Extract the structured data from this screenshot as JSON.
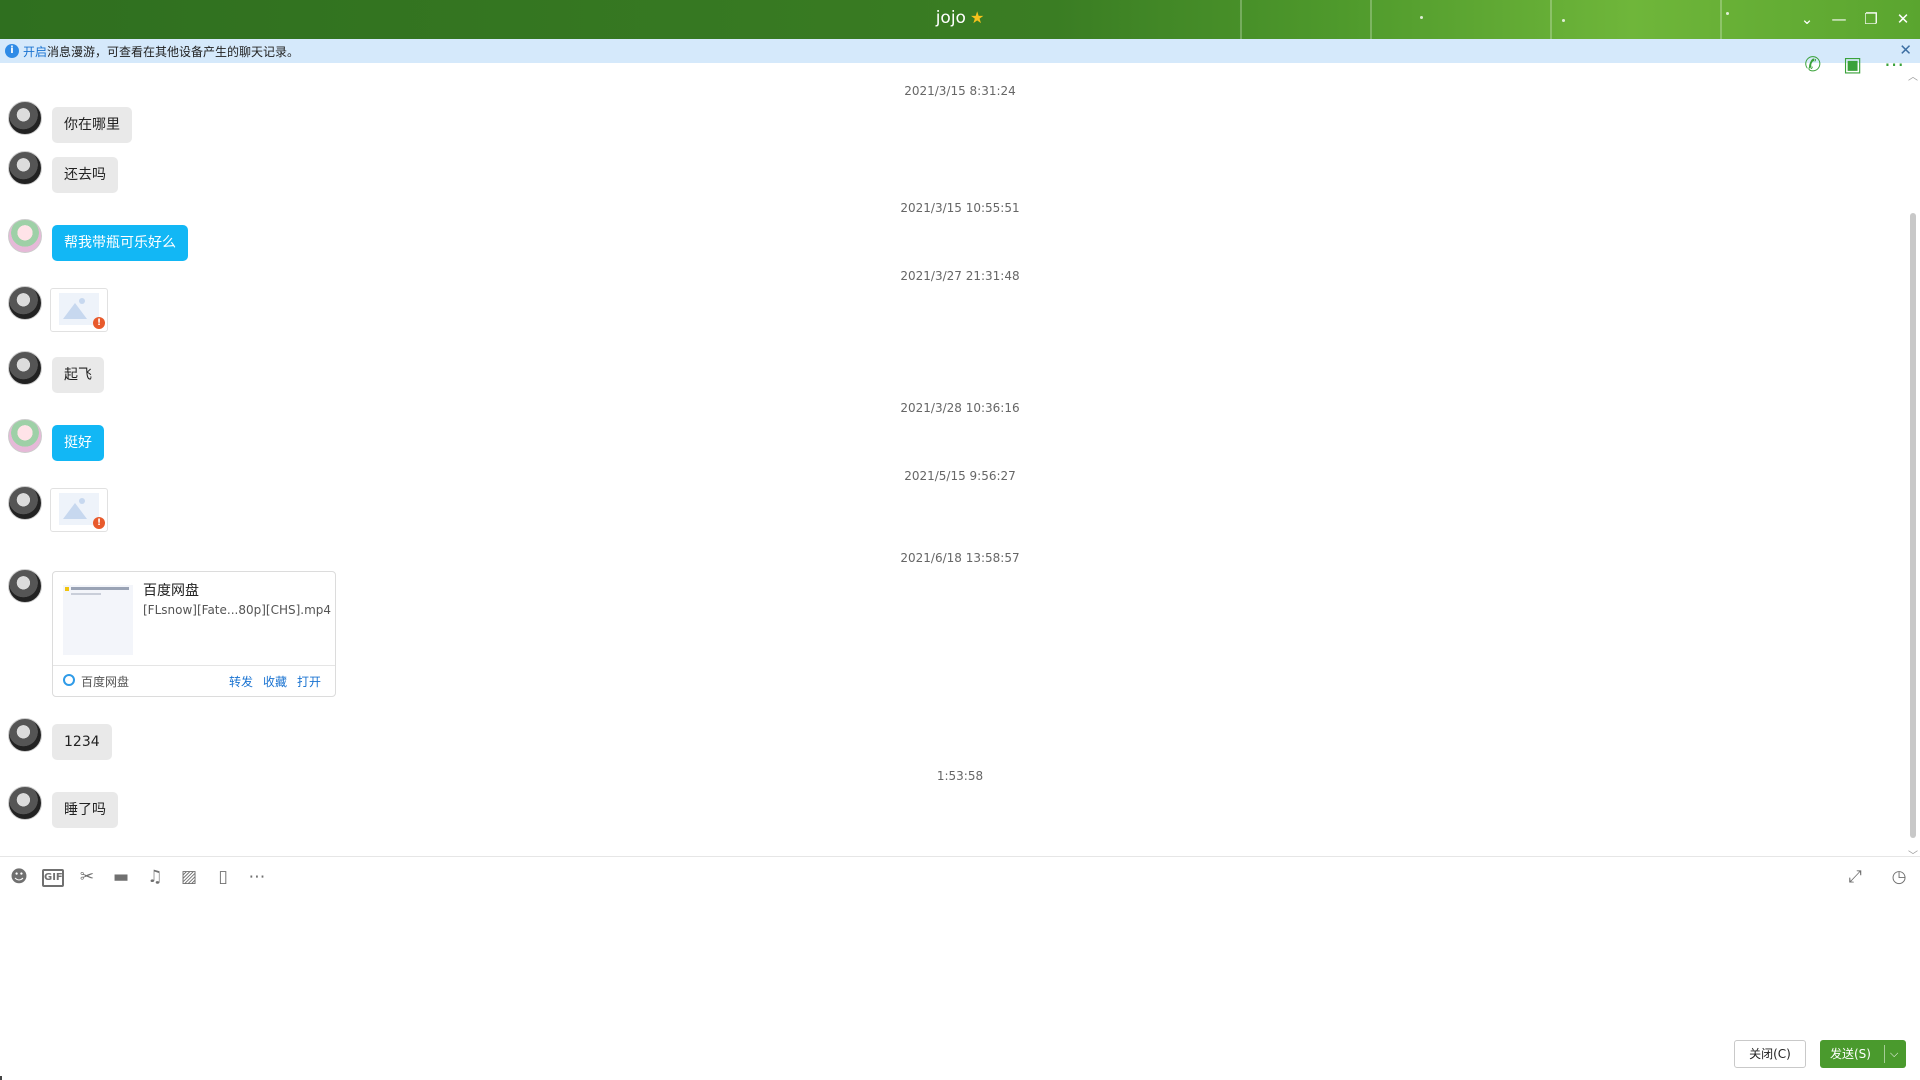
{
  "window": {
    "title": "jojo",
    "star_icon": "star-icon",
    "controls": [
      "chevron-down-icon",
      "minimize-icon",
      "restore-icon",
      "close-icon"
    ]
  },
  "infobar": {
    "link_text": "开启",
    "text": "消息漫游，可查看在其他设备产生的聊天记录。"
  },
  "timestamps": [
    "2021/3/15 8:31:24",
    "2021/3/15 10:55:51",
    "2021/3/27 21:31:48",
    "2021/3/28 10:36:16",
    "2021/5/15 9:56:27",
    "2021/6/18 13:58:57",
    "1:53:58"
  ],
  "messages": [
    {
      "from": "other",
      "text": "你在哪里"
    },
    {
      "from": "other",
      "text": "还去吗"
    },
    {
      "from": "me",
      "text": "帮我带瓶可乐好么"
    },
    {
      "from": "other",
      "type": "image-failed"
    },
    {
      "from": "other",
      "text": "起飞"
    },
    {
      "from": "me",
      "text": "挺好"
    },
    {
      "from": "other",
      "type": "image-failed"
    },
    {
      "from": "other",
      "type": "file-card"
    },
    {
      "from": "other",
      "text": "1234"
    },
    {
      "from": "other",
      "text": "睡了吗"
    }
  ],
  "filecard": {
    "title": "百度网盘",
    "filename": "[FLsnow][Fate...80p][CHS].mp4",
    "source": "百度网盘",
    "actions": [
      "转发",
      "收藏",
      "打开"
    ]
  },
  "toolbar": {
    "icons": [
      "emoji-icon",
      "gif-icon",
      "scissors-icon",
      "folder-icon",
      "music-icon",
      "image-icon",
      "screen-record-icon",
      "more-icon"
    ],
    "gif_label": "GIF",
    "right_icons": [
      "expand-icon",
      "history-icon"
    ]
  },
  "buttons": {
    "close": "关闭(C)",
    "send": "发送(S)"
  }
}
